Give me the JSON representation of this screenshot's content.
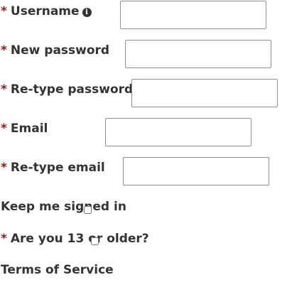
{
  "form": {
    "username": {
      "label": "Username",
      "required_mark": "*",
      "info_icon": "info-circle-icon",
      "value": ""
    },
    "new_password": {
      "label": "New password",
      "required_mark": "*",
      "value": ""
    },
    "retype_password": {
      "label": "Re-type password",
      "required_mark": "*",
      "value": ""
    },
    "email": {
      "label": "Email",
      "required_mark": "*",
      "value": ""
    },
    "retype_email": {
      "label": "Re-type email",
      "required_mark": "*",
      "value": ""
    },
    "keep_signed_in": {
      "label": "Keep me signed in",
      "checked": false
    },
    "age_check": {
      "label": "Are you 13 or older?",
      "required_mark": "*",
      "checked": false
    },
    "terms": {
      "label": "Terms of Service"
    }
  },
  "colors": {
    "required_mark": "#8b1a1a",
    "label_text": "#333333",
    "field_border": "#8f8f8f"
  }
}
